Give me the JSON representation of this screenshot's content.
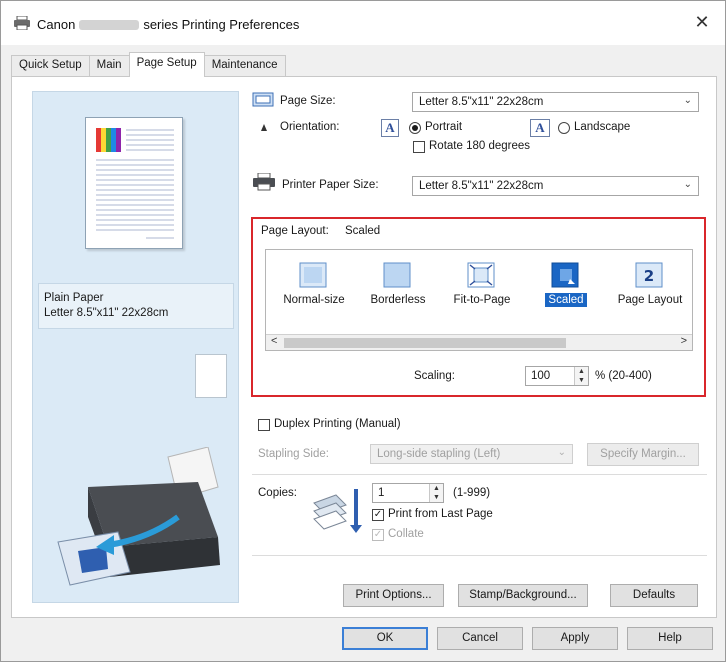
{
  "window": {
    "title_prefix": "Canon",
    "title_suffix": "series Printing Preferences",
    "close_glyph": "✕"
  },
  "tabs": [
    {
      "label": "Quick Setup",
      "active": false
    },
    {
      "label": "Main",
      "active": false
    },
    {
      "label": "Page Setup",
      "active": true
    },
    {
      "label": "Maintenance",
      "active": false
    }
  ],
  "preview": {
    "media_type": "Plain Paper",
    "media_size": "Letter 8.5\"x11\" 22x28cm"
  },
  "page_size": {
    "label": "Page Size:",
    "value": "Letter 8.5\"x11\" 22x28cm"
  },
  "orientation": {
    "label": "Orientation:",
    "portrait": "Portrait",
    "landscape": "Landscape",
    "selected": "Portrait",
    "icon_letter": "A",
    "rotate_label": "Rotate 180 degrees",
    "rotate_checked": false
  },
  "printer_paper_size": {
    "label": "Printer Paper Size:",
    "value": "Letter 8.5\"x11\" 22x28cm"
  },
  "page_layout": {
    "label": "Page Layout:",
    "current": "Scaled",
    "items": [
      {
        "label": "Normal-size",
        "icon": "normal-size-icon"
      },
      {
        "label": "Borderless",
        "icon": "borderless-icon"
      },
      {
        "label": "Fit-to-Page",
        "icon": "fit-to-page-icon"
      },
      {
        "label": "Scaled",
        "icon": "scaled-icon",
        "selected": true
      },
      {
        "label": "Page Layout",
        "icon": "page-layout-icon",
        "badge": "2"
      }
    ],
    "scroll_left": "<",
    "scroll_right": ">",
    "scaling_label": "Scaling:",
    "scaling_value": "100",
    "scaling_range": "% (20-400)"
  },
  "duplex": {
    "label": "Duplex Printing (Manual)",
    "checked": false,
    "stapling_label": "Stapling Side:",
    "stapling_value": "Long-side stapling (Left)",
    "specify_margin": "Specify Margin..."
  },
  "copies": {
    "label": "Copies:",
    "value": "1",
    "range": "(1-999)",
    "print_from_last": "Print from Last Page",
    "print_from_last_checked": true,
    "collate": "Collate",
    "collate_checked": true,
    "check_glyph": "✓"
  },
  "buttons": {
    "print_options": "Print Options...",
    "stamp_background": "Stamp/Background...",
    "defaults": "Defaults",
    "ok": "OK",
    "cancel": "Cancel",
    "apply": "Apply",
    "help": "Help"
  },
  "colors": {
    "selection": "#1a66c4",
    "highlight_border": "#d9262b",
    "preview_bg": "#dbeaf6"
  }
}
